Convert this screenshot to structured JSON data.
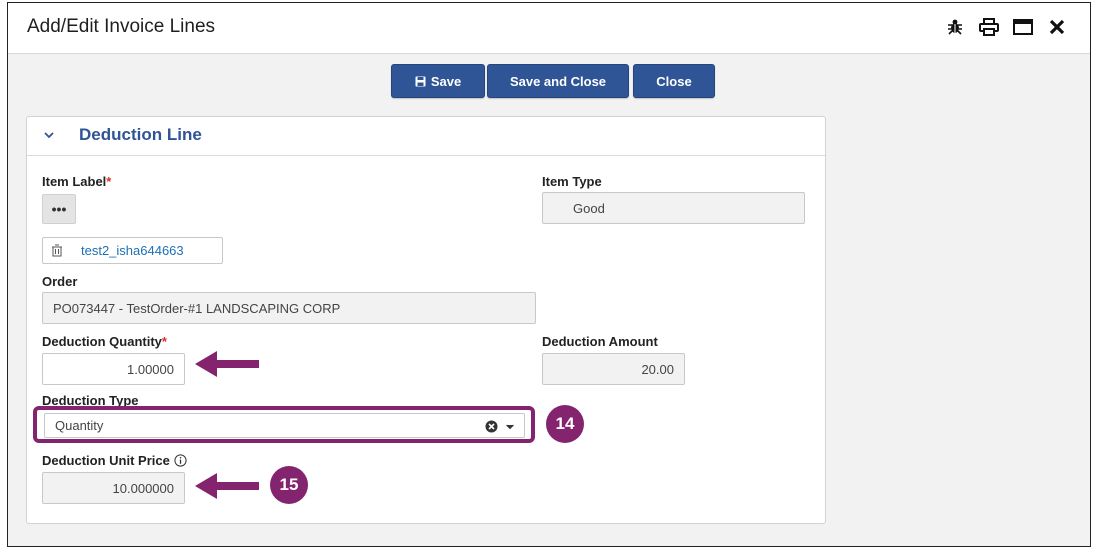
{
  "dialog": {
    "title": "Add/Edit Invoice Lines",
    "icons": [
      "bug-icon",
      "print-icon",
      "maximize-icon",
      "close-icon"
    ]
  },
  "toolbar": {
    "save_label": "Save",
    "save_close_label": "Save and Close",
    "close_label": "Close"
  },
  "section": {
    "title": "Deduction Line",
    "item_label": {
      "label": "Item Label",
      "required_mark": "*",
      "tag_value": "test2_isha644663"
    },
    "item_type": {
      "label": "Item Type",
      "value": "Good"
    },
    "order": {
      "label": "Order",
      "value": "PO073447 - TestOrder-#1 LANDSCAPING CORP"
    },
    "deduction_quantity": {
      "label": "Deduction Quantity",
      "required_mark": "*",
      "value": "1.00000"
    },
    "deduction_amount": {
      "label": "Deduction Amount",
      "value": "20.00"
    },
    "deduction_type": {
      "label": "Deduction Type",
      "value": "Quantity"
    },
    "deduction_unit_price": {
      "label": "Deduction Unit Price",
      "value": "10.000000"
    }
  },
  "annotations": {
    "badge_14": "14",
    "badge_15": "15",
    "accent_color": "#84246f"
  }
}
